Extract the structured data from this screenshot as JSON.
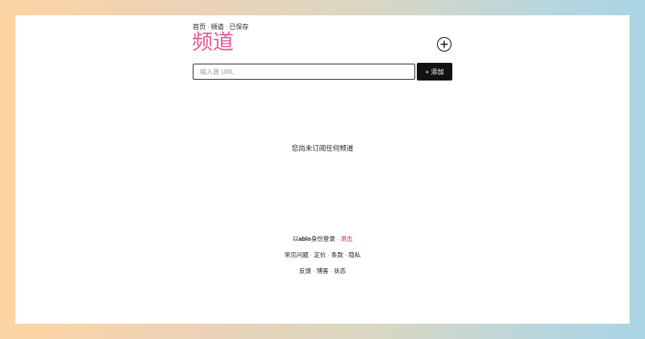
{
  "breadcrumb": {
    "home": "首页",
    "channels": "频道",
    "saved": "已保存",
    "separator": "·"
  },
  "page": {
    "title": "频道",
    "title_color": "#e0599a"
  },
  "add_feed": {
    "placeholder": "输入源 URL",
    "button_label": "+ 添加"
  },
  "empty_state": {
    "message": "您尚未订阅任何频道"
  },
  "footer": {
    "login_prefix": "以",
    "username": "ablo",
    "login_suffix": "身份登录",
    "separator": "·",
    "logout": "退出",
    "logout_color": "#d11f2a",
    "links_row1": [
      "常见问题",
      "定价",
      "条款",
      "隐私"
    ],
    "links_row2": [
      "反馈",
      "博客",
      "状态"
    ]
  }
}
